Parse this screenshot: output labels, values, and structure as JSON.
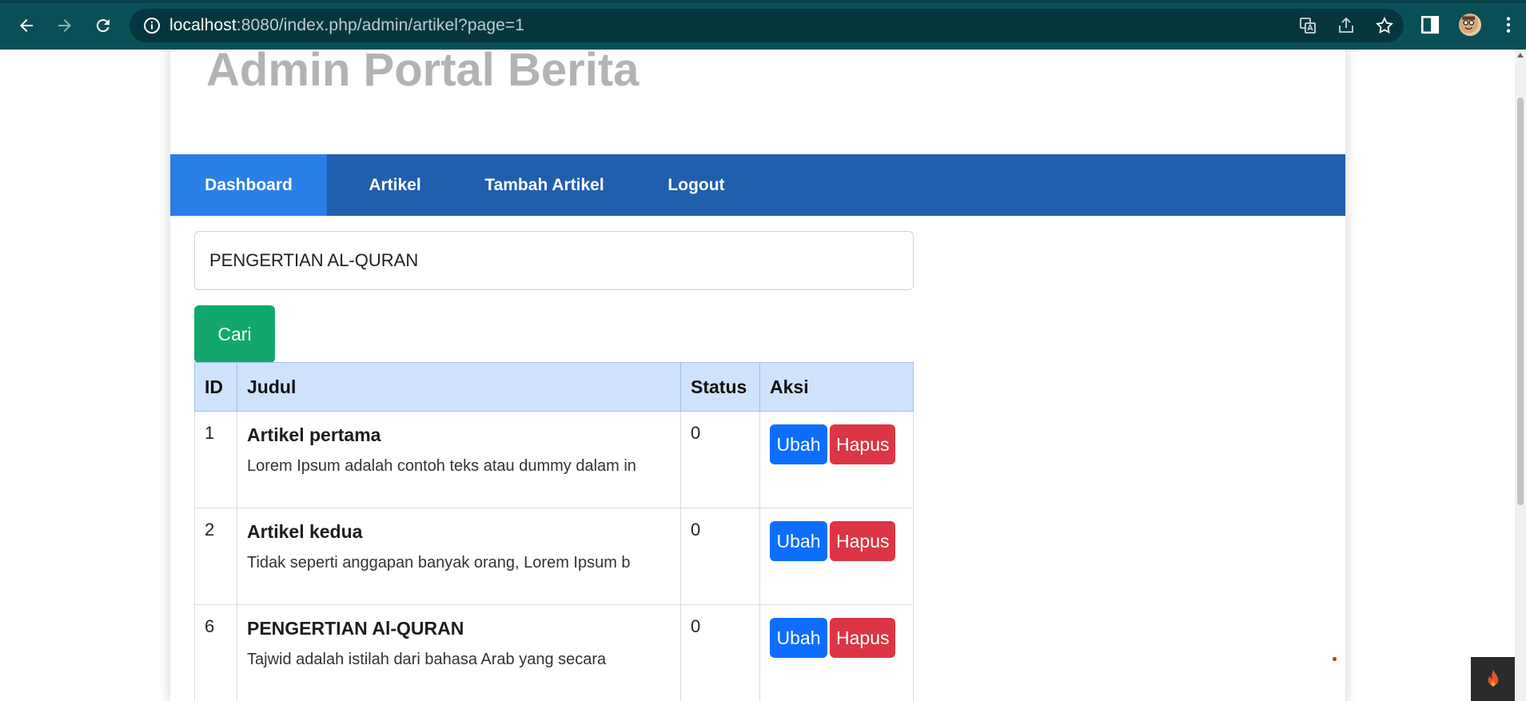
{
  "browser": {
    "url_host": "localhost",
    "url_rest": ":8080/index.php/admin/artikel?page=1"
  },
  "site": {
    "title": "Admin Portal Berita"
  },
  "nav": {
    "items": [
      {
        "label": "Dashboard"
      },
      {
        "label": "Artikel"
      },
      {
        "label": "Tambah Artikel"
      },
      {
        "label": "Logout"
      }
    ]
  },
  "search": {
    "value": "PENGERTIAN AL-QURAN",
    "button_label": "Cari"
  },
  "table": {
    "headers": [
      "ID",
      "Judul",
      "Status",
      "Aksi"
    ],
    "rows": [
      {
        "id": "1",
        "title": "Artikel pertama",
        "desc": "Lorem Ipsum adalah contoh teks atau dummy dalam in",
        "status": "0"
      },
      {
        "id": "2",
        "title": "Artikel kedua",
        "desc": "Tidak seperti anggapan banyak orang, Lorem Ipsum b",
        "status": "0"
      },
      {
        "id": "6",
        "title": "PENGERTIAN Al-QURAN",
        "desc": "Tajwid adalah istilah dari bahasa Arab yang secara",
        "status": "0"
      }
    ],
    "edit_label": "Ubah",
    "delete_label": "Hapus"
  }
}
